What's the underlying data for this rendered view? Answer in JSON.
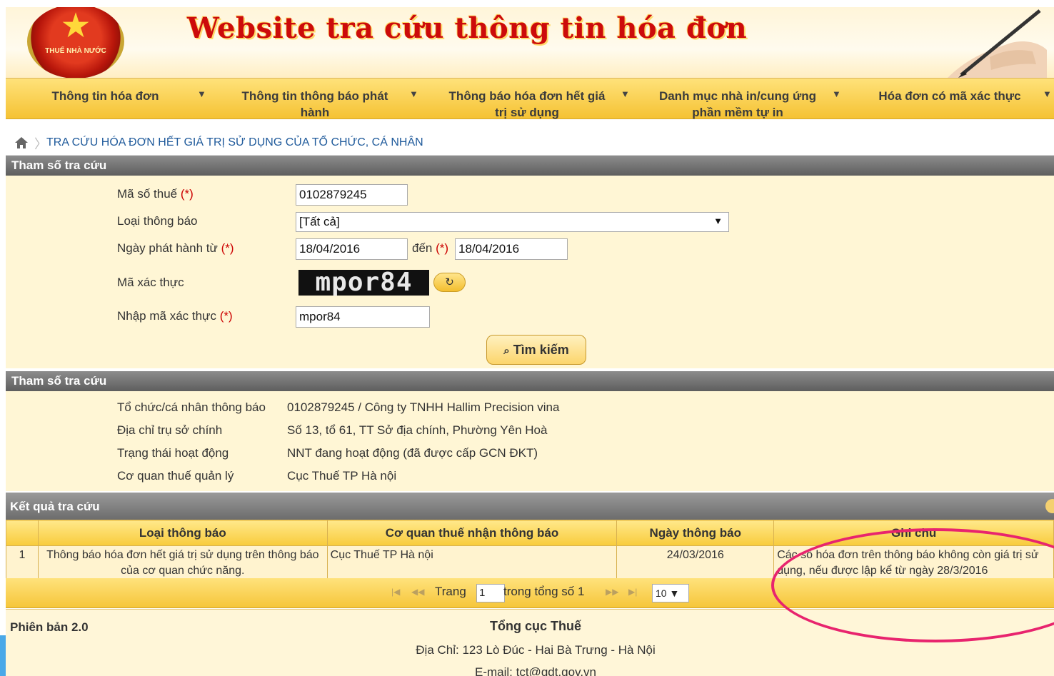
{
  "site": {
    "banner_red_text": "Website tra cứu thông tin hóa đơn",
    "logo_text": "THUẾ NHÀ NƯỚC"
  },
  "nav": {
    "items": [
      {
        "label": "Thông tin hóa đơn"
      },
      {
        "label": "Thông tin thông báo phát hành"
      },
      {
        "label": "Thông báo hóa đơn hết giá trị sử dụng"
      },
      {
        "label": "Danh mục nhà in/cung ứng phần mềm tự in"
      },
      {
        "label": "Hóa đơn có mã xác thực"
      }
    ]
  },
  "breadcrumb": {
    "text": "TRA CỨU HÓA ĐƠN HẾT GIÁ TRỊ SỬ DỤNG CỦA TỔ CHỨC, CÁ NHÂN"
  },
  "search_form": {
    "section_title": "Tham số tra cứu",
    "required_mark": "(*)",
    "tax_code_label": "Mã số thuế",
    "tax_code_value": "0102879245",
    "notice_type_label": "Loại thông báo",
    "notice_type_value": "[Tất cả]",
    "date_from_label": "Ngày phát hành từ",
    "date_from_value": "18/04/2016",
    "date_to_label": "đến",
    "date_to_value": "18/04/2016",
    "captcha_label": "Mã xác thực",
    "captcha_image_text": "mpor84",
    "captcha_input_label": "Nhập mã xác thực",
    "captcha_input_value": "mpor84",
    "search_button": "Tìm kiếm"
  },
  "taxpayer_info": {
    "section_title": "Tham số tra cứu",
    "rows": [
      {
        "label": "Tổ chức/cá nhân thông báo",
        "value": "0102879245 / Công ty TNHH Hallim Precision vina"
      },
      {
        "label": "Địa chỉ trụ sở chính",
        "value": "Số 13, tổ 61, TT Sở địa chính, Phường Yên Hoà"
      },
      {
        "label": "Trạng thái hoạt động",
        "value": "NNT đang hoạt động (đã được cấp GCN ĐKT)"
      },
      {
        "label": "Cơ quan thuế quản lý",
        "value": "Cục Thuế TP Hà nội"
      }
    ]
  },
  "results": {
    "section_title": "Kết quả tra cứu",
    "columns": [
      "",
      "Loại thông báo",
      "Cơ quan thuế nhận thông báo",
      "Ngày thông báo",
      "Ghi chú"
    ],
    "rows": [
      {
        "index": "1",
        "notice_type": "Thông báo hóa đơn hết giá trị sử dụng trên thông báo của cơ quan chức năng.",
        "tax_office": "Cục Thuế TP Hà nội",
        "date": "24/03/2016",
        "note": "Các số hóa đơn trên thông báo không còn giá trị sử dụng, nếu được lập kể từ ngày 28/3/2016"
      }
    ]
  },
  "pager": {
    "page_label": "Trang",
    "page_value": "1",
    "total_label": "trong tổng số 1",
    "page_size": "10"
  },
  "footer": {
    "version": "Phiên bản 2.0",
    "org": "Tổng cục Thuế",
    "address": "Địa Chỉ: 123 Lò Đúc - Hai Bà Trưng - Hà Nội",
    "email": "E-mail: tct@gdt.gov.vn"
  },
  "colors": {
    "accent_yellow": "#f5c233",
    "title_red": "#cc0b0b",
    "highlight_pink": "#e8246e",
    "section_grey": "#6c6c6c"
  }
}
